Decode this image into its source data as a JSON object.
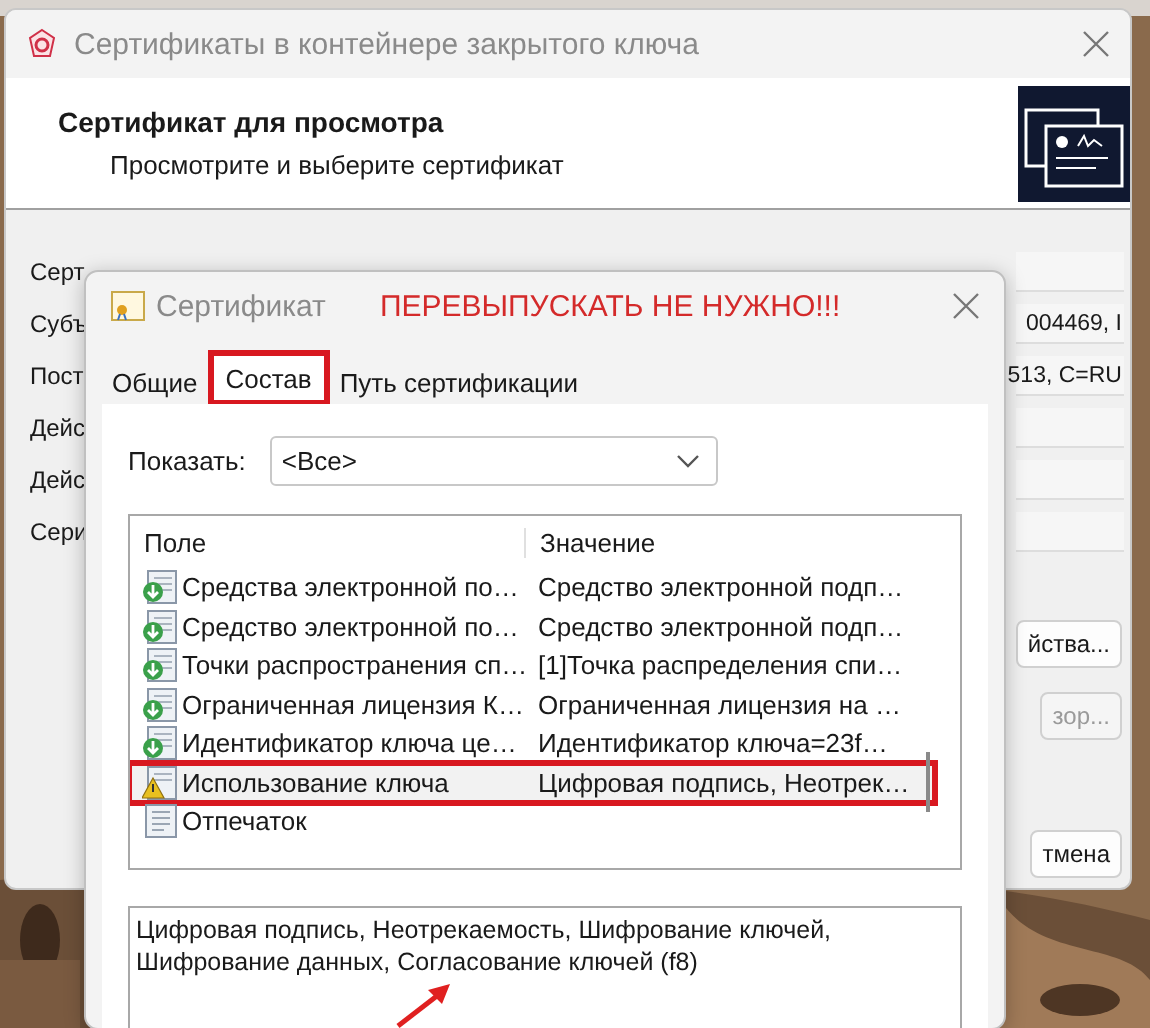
{
  "window": {
    "title": "Сертификаты в контейнере закрытого ключа",
    "header_title": "Сертификат для просмотра",
    "header_subtitle": "Просмотрите и выберите сертификат",
    "fields": [
      {
        "label": "Серт"
      },
      {
        "label": "Субъ",
        "value": "004469, I"
      },
      {
        "label": "Пост",
        "value": "513, C=RU"
      },
      {
        "label": "Дейс"
      },
      {
        "label": "Дейс"
      },
      {
        "label": "Сери"
      }
    ],
    "buttons": [
      {
        "label": "йства...",
        "disabled": false
      },
      {
        "label": "зор...",
        "disabled": true
      },
      {
        "label": "тмена",
        "disabled": false
      }
    ]
  },
  "dialog": {
    "title": "Сертификат",
    "note": "ПЕРЕВЫПУСКАТЬ НЕ НУЖНО!!!",
    "tabs": [
      {
        "label": "Общие",
        "selected": false,
        "highlighted": false
      },
      {
        "label": "Состав",
        "selected": true,
        "highlighted": true
      },
      {
        "label": "Путь сертификации",
        "selected": false,
        "highlighted": false
      }
    ],
    "show": {
      "label": "Показать:",
      "value": "<Все>"
    },
    "columns": [
      "Поле",
      "Значение"
    ],
    "rows": [
      {
        "kind": "extension",
        "field": "Средства электронной по…",
        "value": "Средство электронной подп…",
        "highlighted": false
      },
      {
        "kind": "extension",
        "field": "Средство электронной по…",
        "value": "Средство электронной подп…",
        "highlighted": false
      },
      {
        "kind": "extension",
        "field": "Точки распространения сп…",
        "value": "[1]Точка распределения спи…",
        "highlighted": false
      },
      {
        "kind": "extension",
        "field": "Ограниченная лицензия К…",
        "value": "Ограниченная лицензия на …",
        "highlighted": false
      },
      {
        "kind": "extension",
        "field": "Идентификатор ключа це…",
        "value": "Идентификатор ключа=23f…",
        "highlighted": false
      },
      {
        "kind": "critical",
        "field": "Использование ключа",
        "value": "Цифровая подпись, Неотрек…",
        "highlighted": true
      },
      {
        "kind": "property",
        "field": "Отпечаток",
        "highlighted": false
      }
    ],
    "detail": {
      "text": "Цифровая подпись, Неотрекаемость, Шифрование ключей, Шифрование данных, Согласование ключей (f8)",
      "arrow": true
    }
  }
}
